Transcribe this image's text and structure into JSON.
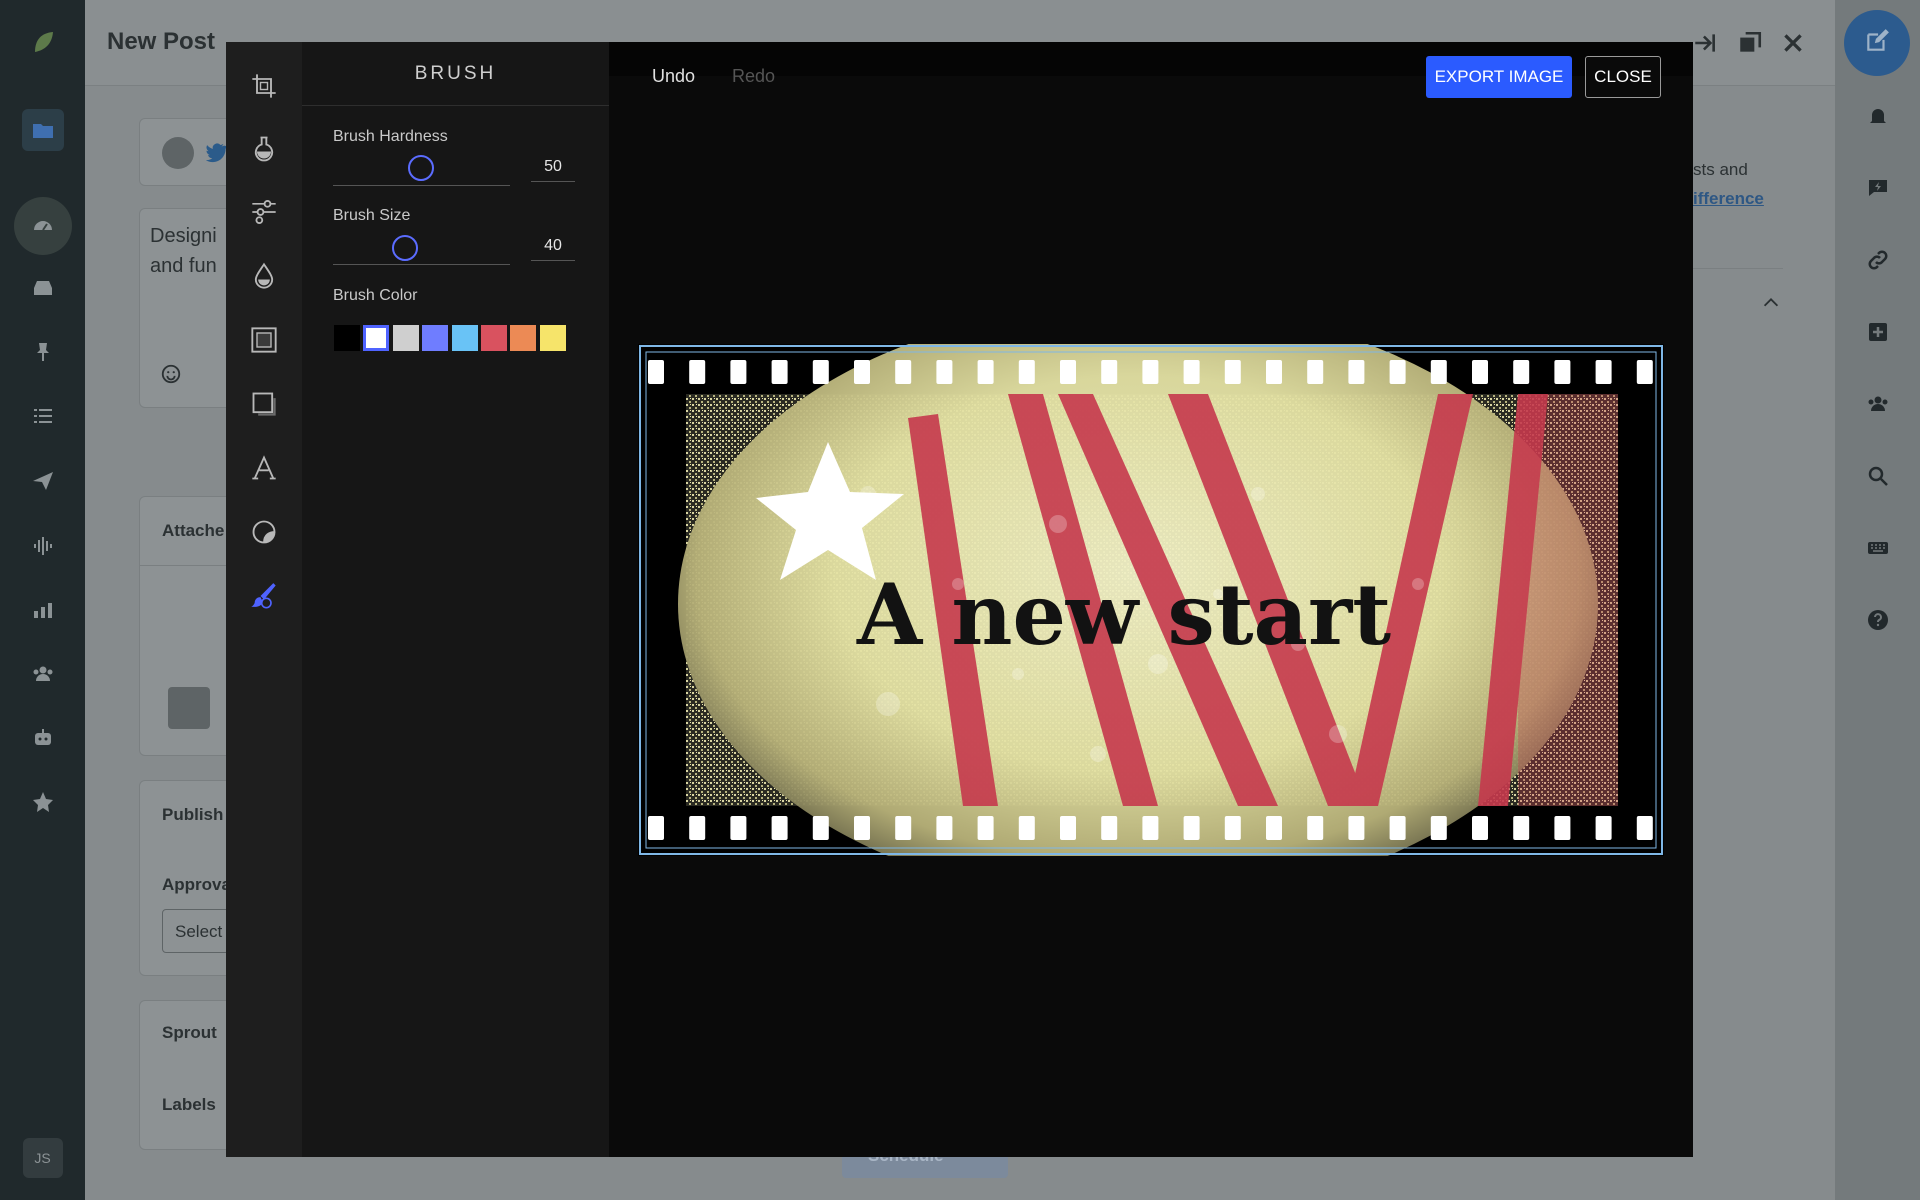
{
  "app": {
    "post_title": "New Post",
    "editor_text_line1": "Designi",
    "editor_text_line2": "and fun",
    "attached_label": "Attache",
    "publish_label": "Publish",
    "approval_label": "Approva",
    "select_label": "Select",
    "sprout_label": "Sprout",
    "labels_label": "Labels",
    "side_text": "sts and",
    "side_link": "ifference",
    "schedule_label": "Schedule",
    "avatar_initials": "JS"
  },
  "editor": {
    "panel_title": "BRUSH",
    "undo_label": "Undo",
    "redo_label": "Redo",
    "export_label": "EXPORT IMAGE",
    "close_label": "CLOSE",
    "hardness": {
      "label": "Brush Hardness",
      "value": "50"
    },
    "size": {
      "label": "Brush Size",
      "value": "40"
    },
    "color_label": "Brush Color",
    "colors": [
      "#000000",
      "#ffffff",
      "#cfcfcf",
      "#6f7dff",
      "#69c3f6",
      "#d9525f",
      "#ec8a55",
      "#f6e46a"
    ],
    "selected_color_index": 1,
    "image_text": "A new start"
  }
}
